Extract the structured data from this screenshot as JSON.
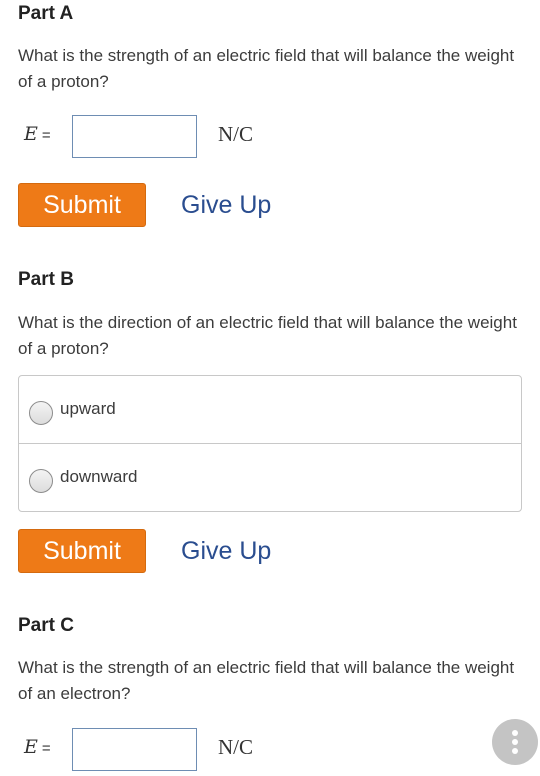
{
  "part_a": {
    "title": "Part A",
    "question": "What is the strength of an electric field that will balance the weight of a proton?",
    "equation_var": "E",
    "equation_sign": "=",
    "input_value": "",
    "unit": "N/C",
    "submit_label": "Submit",
    "give_up_label": "Give Up"
  },
  "part_b": {
    "title": "Part B",
    "question": "What is the direction of an electric field that will balance the weight of a proton?",
    "options": [
      {
        "label": "upward"
      },
      {
        "label": "downward"
      }
    ],
    "submit_label": "Submit",
    "give_up_label": "Give Up"
  },
  "part_c": {
    "title": "Part C",
    "question": "What is the strength of an electric field that will balance the weight of an electron?",
    "equation_var": "E",
    "equation_sign": "=",
    "input_value": "",
    "unit": "N/C"
  },
  "fab": {
    "icon": "vertical-dots-icon"
  },
  "colors": {
    "submit_bg": "#ee7a17",
    "link": "#2a4d8f",
    "input_border": "#6e8db3"
  }
}
